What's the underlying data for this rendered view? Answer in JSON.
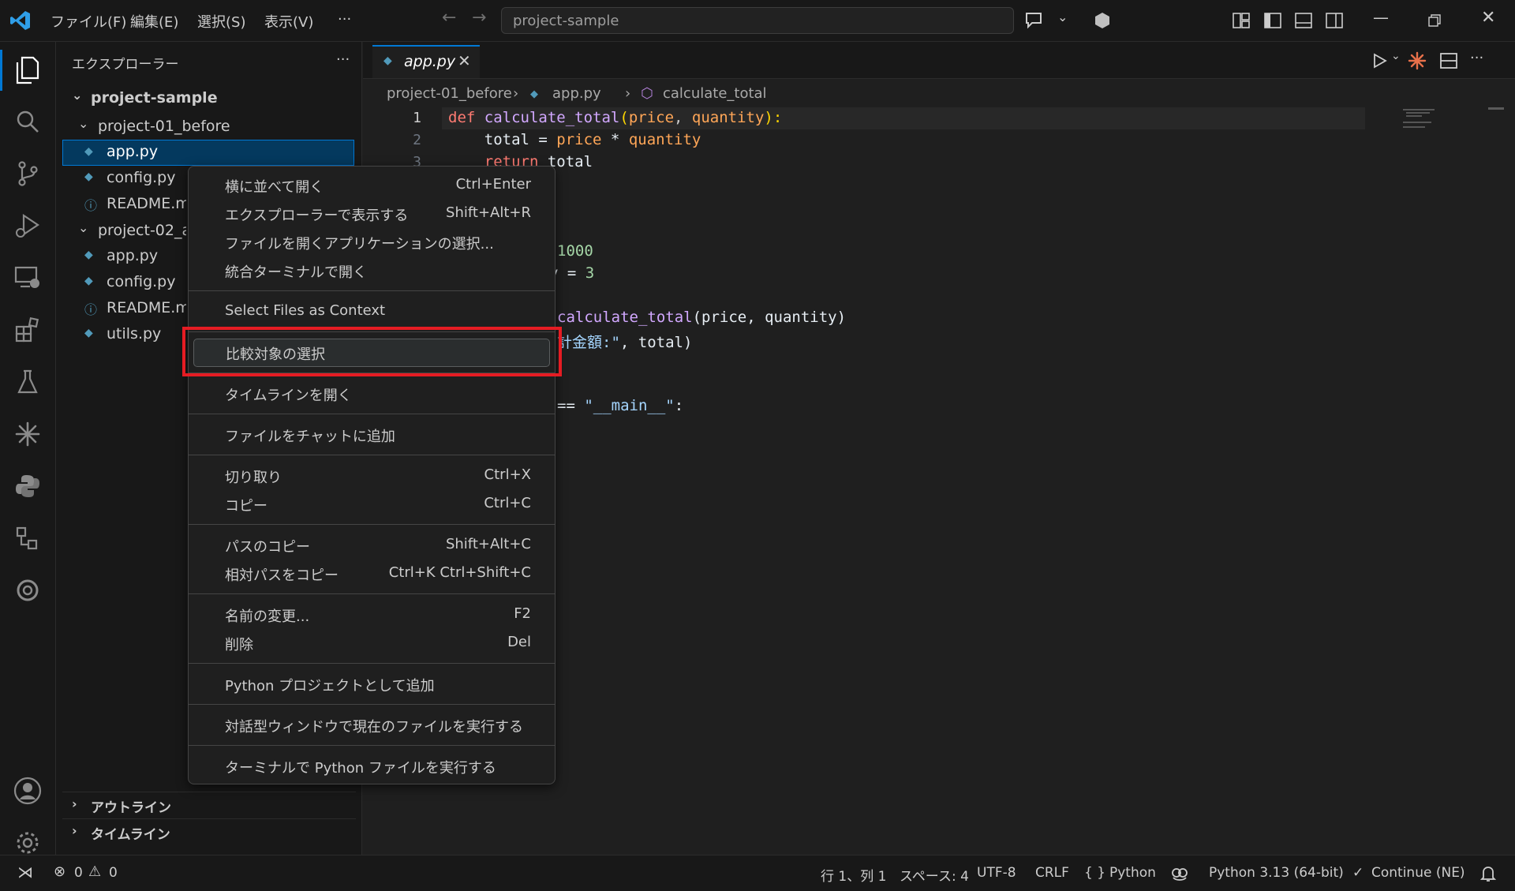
{
  "titlebar": {
    "menus": [
      "ファイル(F)",
      "編集(E)",
      "選択(S)",
      "表示(V)"
    ],
    "more": "···",
    "search_text": "project-sample"
  },
  "sidebar": {
    "title": "エクスプローラー",
    "more": "···",
    "root": "project-sample",
    "folder1": "project-01_before",
    "folder1_files": [
      "app.py",
      "config.py",
      "README.md"
    ],
    "folder2": "project-02_after",
    "folder2_files": [
      "app.py",
      "config.py",
      "README.md",
      "utils.py"
    ],
    "outline": "アウトライン",
    "timeline": "タイムライン"
  },
  "editor": {
    "tab_label": "app.py",
    "breadcrumb": [
      "project-01_before",
      "app.py",
      "calculate_total"
    ],
    "line_numbers": [
      "1",
      "2",
      "3"
    ],
    "code": {
      "l1_kw": "def ",
      "l1_fn": "calculate_total",
      "l1_p1": "(",
      "l1_a1": "price",
      "l1_c": ", ",
      "l1_a2": "quantity",
      "l1_p2": "):",
      "l2_a": "    total = ",
      "l2_b": "price",
      "l2_c": " * ",
      "l2_d": "quantity",
      "l3_kw": "    return",
      "l3_b": " total",
      "l4": "1000",
      "l5_a": "y = ",
      "l5_b": "3",
      "l6_fn": "calculate_total",
      "l6_b": "(price, quantity)",
      "l7_a": "計金額:\"",
      "l7_b": ", total)",
      "l8_a": "== ",
      "l8_b": "\"__main__\"",
      "l8_c": ":"
    }
  },
  "context_menu": {
    "items": [
      {
        "label": "横に並べて開く",
        "key": "Ctrl+Enter"
      },
      {
        "label": "エクスプローラーで表示する",
        "key": "Shift+Alt+R"
      },
      {
        "label": "ファイルを開くアプリケーションの選択...",
        "key": ""
      },
      {
        "label": "統合ターミナルで開く",
        "key": ""
      },
      {
        "label": "Select Files as Context",
        "key": ""
      },
      {
        "label": "比較対象の選択",
        "key": ""
      },
      {
        "label": "タイムラインを開く",
        "key": ""
      },
      {
        "label": "ファイルをチャットに追加",
        "key": ""
      },
      {
        "label": "切り取り",
        "key": "Ctrl+X"
      },
      {
        "label": "コピー",
        "key": "Ctrl+C"
      },
      {
        "label": "パスのコピー",
        "key": "Shift+Alt+C"
      },
      {
        "label": "相対パスをコピー",
        "key": "Ctrl+K Ctrl+Shift+C"
      },
      {
        "label": "名前の変更...",
        "key": "F2"
      },
      {
        "label": "削除",
        "key": "Del"
      },
      {
        "label": "Python プロジェクトとして追加",
        "key": ""
      },
      {
        "label": "対話型ウィンドウで現在のファイルを実行する",
        "key": ""
      },
      {
        "label": "ターミナルで Python ファイルを実行する",
        "key": ""
      }
    ]
  },
  "statusbar": {
    "errors": "0",
    "warnings": "0",
    "position": "行 1、列 1",
    "spaces": "スペース: 4",
    "encoding": "UTF-8",
    "eol": "CRLF",
    "language": "Python",
    "interpreter": "Python 3.13 (64-bit)",
    "continue": "Continue (NE)"
  },
  "colors": {
    "accent": "#0078d4",
    "highlight_box": "#e51c23",
    "keyword": "#ff7b72",
    "function": "#d2a8ff",
    "param": "#ffa657",
    "number": "#a5d6a7",
    "string": "#a5d6ff"
  }
}
